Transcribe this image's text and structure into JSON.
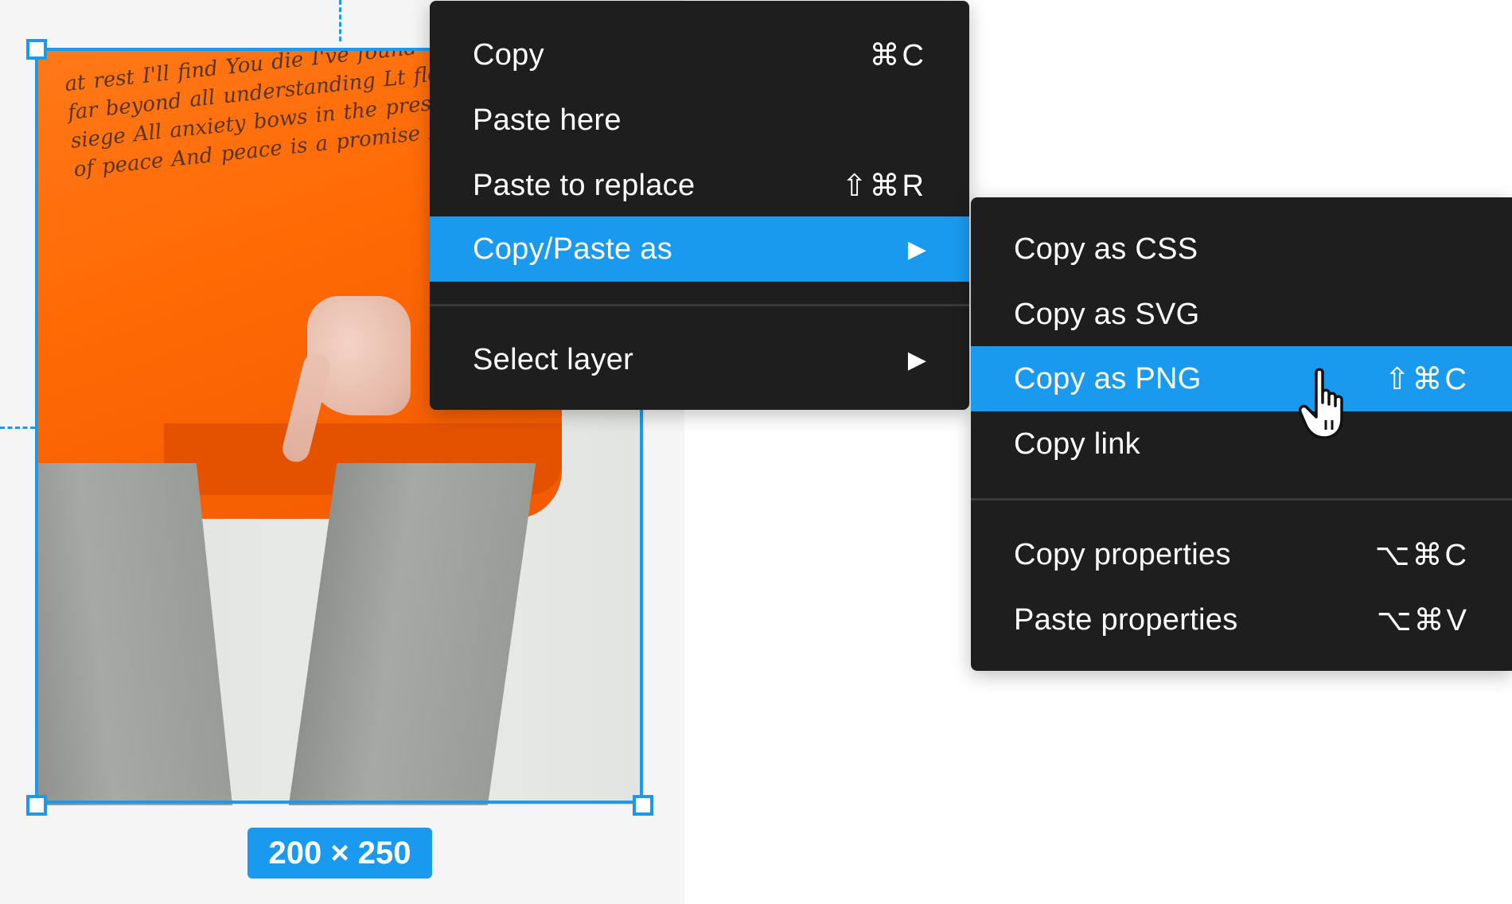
{
  "canvas": {
    "dimensions_badge": "200 × 250"
  },
  "context_menu": {
    "items": [
      {
        "label": "Copy",
        "shortcut": "⌘C"
      },
      {
        "label": "Paste here"
      },
      {
        "label": "Paste to replace",
        "shortcut": "⇧⌘R"
      },
      {
        "label": "Copy/Paste as",
        "active": true,
        "has_submenu": true,
        "arrow": "▶"
      },
      {
        "label": "Select layer",
        "has_submenu": true,
        "arrow": "▶"
      }
    ]
  },
  "submenu": {
    "items": [
      {
        "label": "Copy as CSS"
      },
      {
        "label": "Copy as SVG"
      },
      {
        "label": "Copy as PNG",
        "shortcut": "⇧⌘C",
        "active": true
      },
      {
        "label": "Copy link"
      },
      {
        "label": "Copy properties",
        "shortcut": "⌥⌘C"
      },
      {
        "label": "Paste properties",
        "shortcut": "⌥⌘V"
      }
    ]
  },
  "colors": {
    "accent": "#1a9aef",
    "menu_bg": "#1e1e1e",
    "separator": "#3a3a3a",
    "canvas_bg": "#f5f5f5",
    "shirt": "#ff6a05"
  },
  "icons": {
    "submenu_arrow": "triangle-right-icon",
    "cursor": "hand-pointer-icon"
  }
}
